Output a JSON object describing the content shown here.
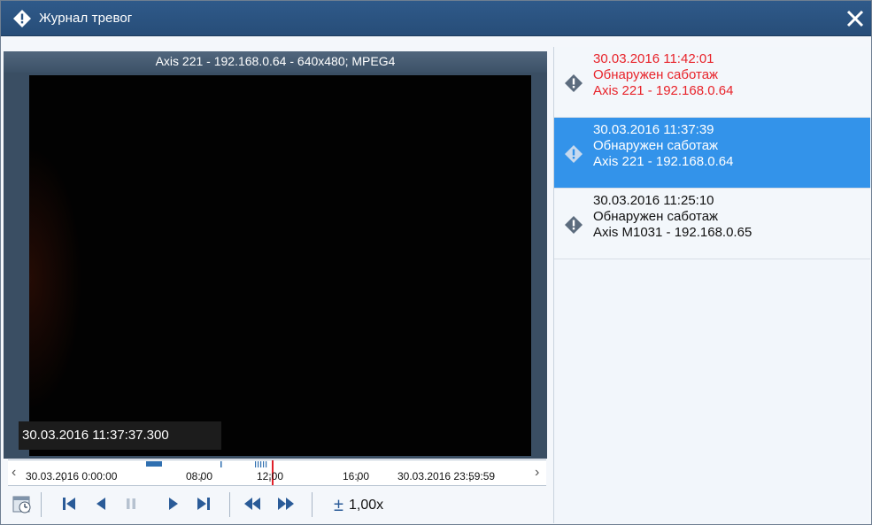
{
  "window": {
    "title": "Журнал тревог",
    "title_icon": "alarm-diamond-icon",
    "close_icon": "close-icon"
  },
  "video": {
    "camera_header": "Axis 221 - 192.168.0.64 - 640x480; MPEG4",
    "timestamp": "30.03.2016 11:37:37.300"
  },
  "timeline": {
    "start_label": "30.03.2016 0:00:00",
    "tick_labels": [
      "08:00",
      "12:00",
      "16:00"
    ],
    "end_label": "30.03.2016 23:59:59",
    "prev_icon": "chevron-left-icon",
    "next_icon": "chevron-right-icon",
    "marker_color": "#e0202a",
    "event_color": "#2f6fb0"
  },
  "controls": {
    "icons": [
      "calendar-clock-icon",
      "skip-to-start-icon",
      "step-back-icon",
      "pause-icon",
      "play-icon",
      "skip-to-end-icon",
      "rewind-icon",
      "fast-forward-icon"
    ],
    "speed_symbol": "±",
    "speed_value": "1,00x"
  },
  "alarms": [
    {
      "time": "30.03.2016 11:42:01",
      "event": "Обнаружен саботаж",
      "camera": "Axis 221 - 192.168.0.64",
      "state": "new",
      "icon": "alarm-diamond-icon"
    },
    {
      "time": "30.03.2016 11:37:39",
      "event": "Обнаружен саботаж",
      "camera": "Axis 221 - 192.168.0.64",
      "state": "selected",
      "icon": "alarm-diamond-icon"
    },
    {
      "time": "30.03.2016 11:25:10",
      "event": "Обнаружен саботаж",
      "camera": "Axis M1031 - 192.168.0.65",
      "state": "normal",
      "icon": "alarm-diamond-icon"
    }
  ],
  "colors": {
    "titlebar": "#2b5482",
    "selection": "#3393ea",
    "new_alarm_text": "#e8232a"
  }
}
